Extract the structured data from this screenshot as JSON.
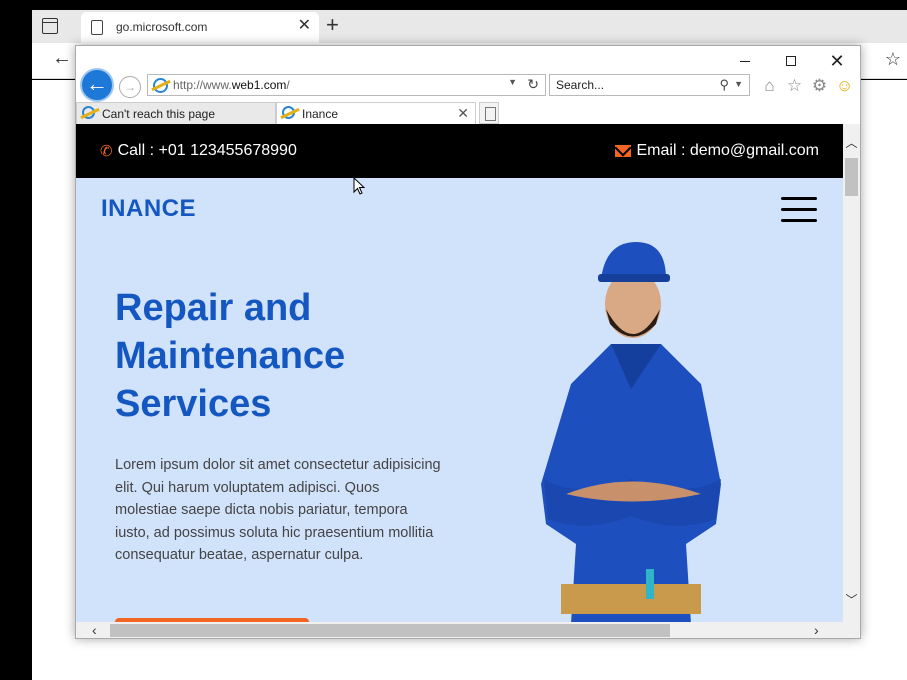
{
  "outer_browser": {
    "tab_title": "go.microsoft.com",
    "close_glyph": "✕",
    "new_tab_glyph": "+",
    "back_glyph": "←",
    "favorites_glyph": "☆"
  },
  "ie": {
    "address": {
      "prefix": "http://www.",
      "domain": "web1.com",
      "suffix": "/"
    },
    "search_placeholder": "Search...",
    "tabs": [
      {
        "title": "Can't reach this page"
      },
      {
        "title": "Inance"
      }
    ],
    "tab_close_glyph": "✕"
  },
  "site": {
    "call": "Call : +01 123455678990",
    "email": "Email : demo@gmail.com",
    "brand": "INANCE",
    "hero_title": "Repair and Maintenance Services",
    "hero_text": "Lorem ipsum dolor sit amet consectetur adipisicing elit. Qui harum voluptatem adipisci. Quos molestiae saepe dicta nobis pariatur, tempora iusto, ad possimus soluta hic praesentium mollitia consequatur beatae, aspernatur culpa."
  },
  "colors": {
    "accent_orange": "#f26522",
    "brand_blue": "#1557c0",
    "hero_bg": "#d1e2fb"
  }
}
